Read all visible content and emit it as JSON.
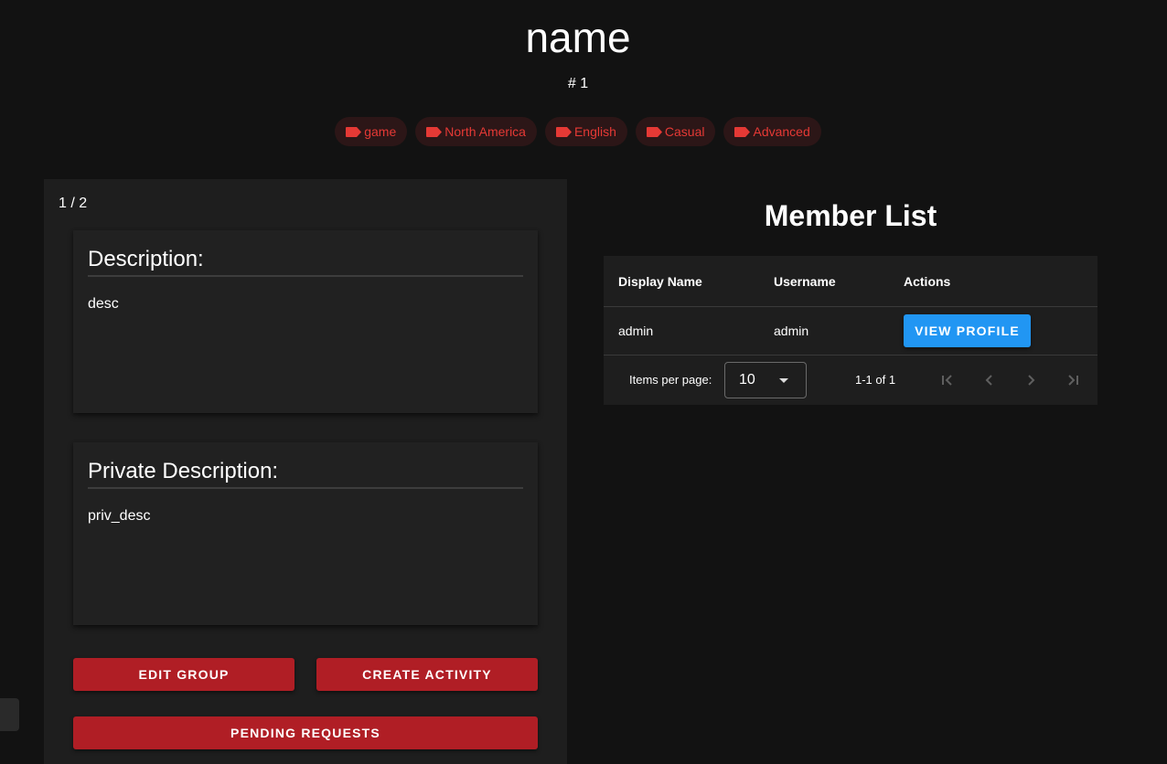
{
  "header": {
    "title": "name",
    "group_number": "# 1"
  },
  "tags": [
    {
      "label": "game",
      "icon": "label-icon"
    },
    {
      "label": "North America",
      "icon": "label-icon"
    },
    {
      "label": "English",
      "icon": "label-icon"
    },
    {
      "label": "Casual",
      "icon": "label-icon"
    },
    {
      "label": "Advanced",
      "icon": "label-icon"
    }
  ],
  "carousel": {
    "counter": "1 / 2"
  },
  "description": {
    "heading": "Description:",
    "text": "desc"
  },
  "private_description": {
    "heading": "Private Description:",
    "text": "priv_desc"
  },
  "actions": {
    "edit_group": "EDIT GROUP",
    "create_activity": "CREATE ACTIVITY",
    "pending_requests": "PENDING REQUESTS"
  },
  "member_list": {
    "title": "Member List",
    "columns": [
      "Display Name",
      "Username",
      "Actions"
    ],
    "rows": [
      {
        "display_name": "admin",
        "username": "admin",
        "action_label": "VIEW PROFILE"
      }
    ],
    "footer": {
      "items_per_page_label": "Items per page:",
      "items_per_page_value": "10",
      "range_text": "1-1 of 1"
    }
  },
  "colors": {
    "background": "#121212",
    "panel": "#1e1e1e",
    "tag_text": "#e53935",
    "primary_red": "#b01e25",
    "primary_blue": "#2196f3"
  }
}
